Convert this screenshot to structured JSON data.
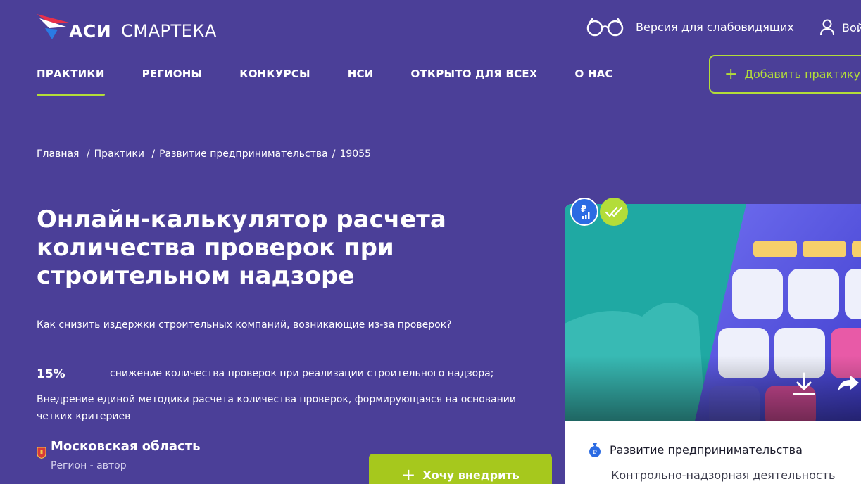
{
  "header": {
    "logo_asi": "АСИ",
    "logo_smart": "СМАРТЕКА",
    "vision_label": "Версия для слабовидящих",
    "login_label": "Войти"
  },
  "nav": {
    "items": [
      {
        "label": "ПРАКТИКИ",
        "active": true
      },
      {
        "label": "РЕГИОНЫ",
        "active": false
      },
      {
        "label": "КОНКУРСЫ",
        "active": false
      },
      {
        "label": "НСИ",
        "active": false
      },
      {
        "label": "ОТКРЫТО ДЛЯ ВСЕХ",
        "active": false
      },
      {
        "label": "О НАС",
        "active": false
      }
    ],
    "add_practice": "Добавить практику"
  },
  "breadcrumb": {
    "home": "Главная",
    "practices": "Практики",
    "section": "Развитие предпринимательства",
    "id": "19055"
  },
  "main": {
    "title": "Онлайн-калькулятор расчета количества проверок при строительном надзоре",
    "subtitle": "Как снизить издержки строительных компаний, возникающие из-за проверок?",
    "stat_value": "15%",
    "stat_text": "снижение количества проверок при реализации строительного надзора;",
    "description": "Внедрение единой методики расчета количества проверок, формирующаяся на основании четких критериев",
    "region_name": "Московская область",
    "region_role": "Регион - автор",
    "want_button": "Хочу внедрить"
  },
  "card": {
    "category": "Развитие предпринимательства",
    "subcategory": "Контрольно-надзорная деятельность"
  },
  "colors": {
    "background": "#4b3f98",
    "accent": "#b3dd39",
    "button_green": "#a6c81d",
    "badge_blue": "#2b6be3"
  }
}
